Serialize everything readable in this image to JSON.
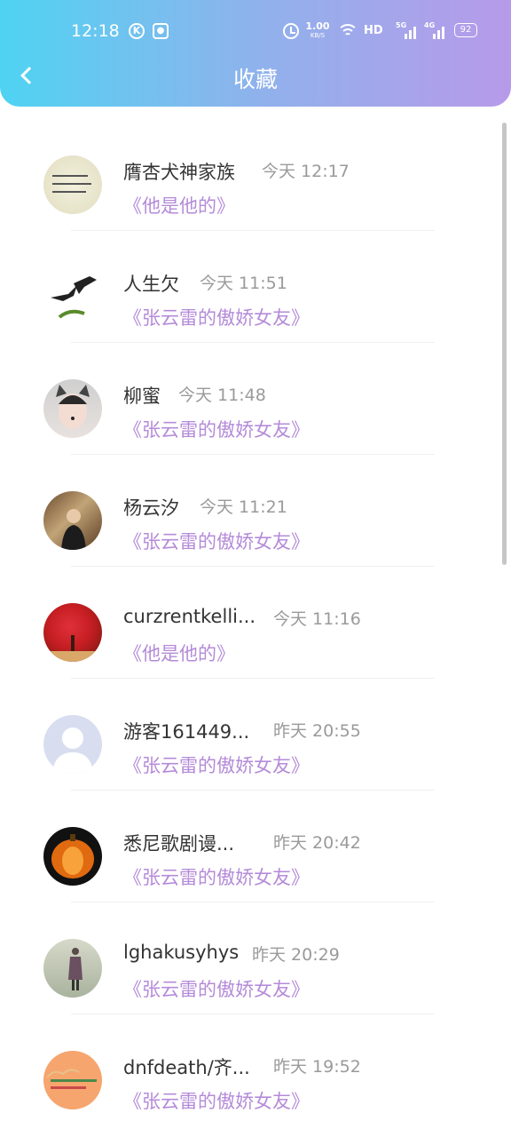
{
  "status_bar": {
    "time": "12:18",
    "k_icon": "K",
    "speed_value": "1.00",
    "speed_unit": "KB/S",
    "hd": "HD",
    "net1": "5G",
    "net2": "4G",
    "battery": "92"
  },
  "header": {
    "title": "收藏",
    "gradient": [
      "#4fd3f2",
      "#b79ae9"
    ]
  },
  "colors": {
    "name": "#333333",
    "time": "#9a9a9a",
    "book": "#b48bd8"
  },
  "items": [
    {
      "name": "膺杏犬神家族",
      "time": "今天 12:17",
      "book": "《他是他的》",
      "avatar": "handwriting-avatar"
    },
    {
      "name": "人生欠",
      "time": "今天 11:51",
      "book": "《张云雷的傲娇女友》",
      "avatar": "swallows-avatar"
    },
    {
      "name": "柳蜜",
      "time": "今天 11:48",
      "book": "《张云雷的傲娇女友》",
      "avatar": "cat-filter-selfie-avatar"
    },
    {
      "name": "杨云汐",
      "time": "今天 11:21",
      "book": "《张云雷的傲娇女友》",
      "avatar": "street-portrait-avatar"
    },
    {
      "name": "curzrentkelli...",
      "time": "今天 11:16",
      "book": "《他是他的》",
      "avatar": "red-tree-avatar"
    },
    {
      "name": "游客161449...",
      "time": "昨天 20:55",
      "book": "《张云雷的傲娇女友》",
      "avatar": "default-user-avatar"
    },
    {
      "name": "悉尼歌剧谩...",
      "time": "昨天 20:42",
      "book": "《张云雷的傲娇女友》",
      "avatar": "pumpkin-avatar"
    },
    {
      "name": "lghakusyhys",
      "time": "昨天 20:29",
      "book": "《张云雷的傲娇女友》",
      "avatar": "misty-figure-avatar"
    },
    {
      "name": "dnfdeath/齐...",
      "time": "昨天 19:52",
      "book": "《张云雷的傲娇女友》",
      "avatar": "orange-text-avatar"
    }
  ]
}
